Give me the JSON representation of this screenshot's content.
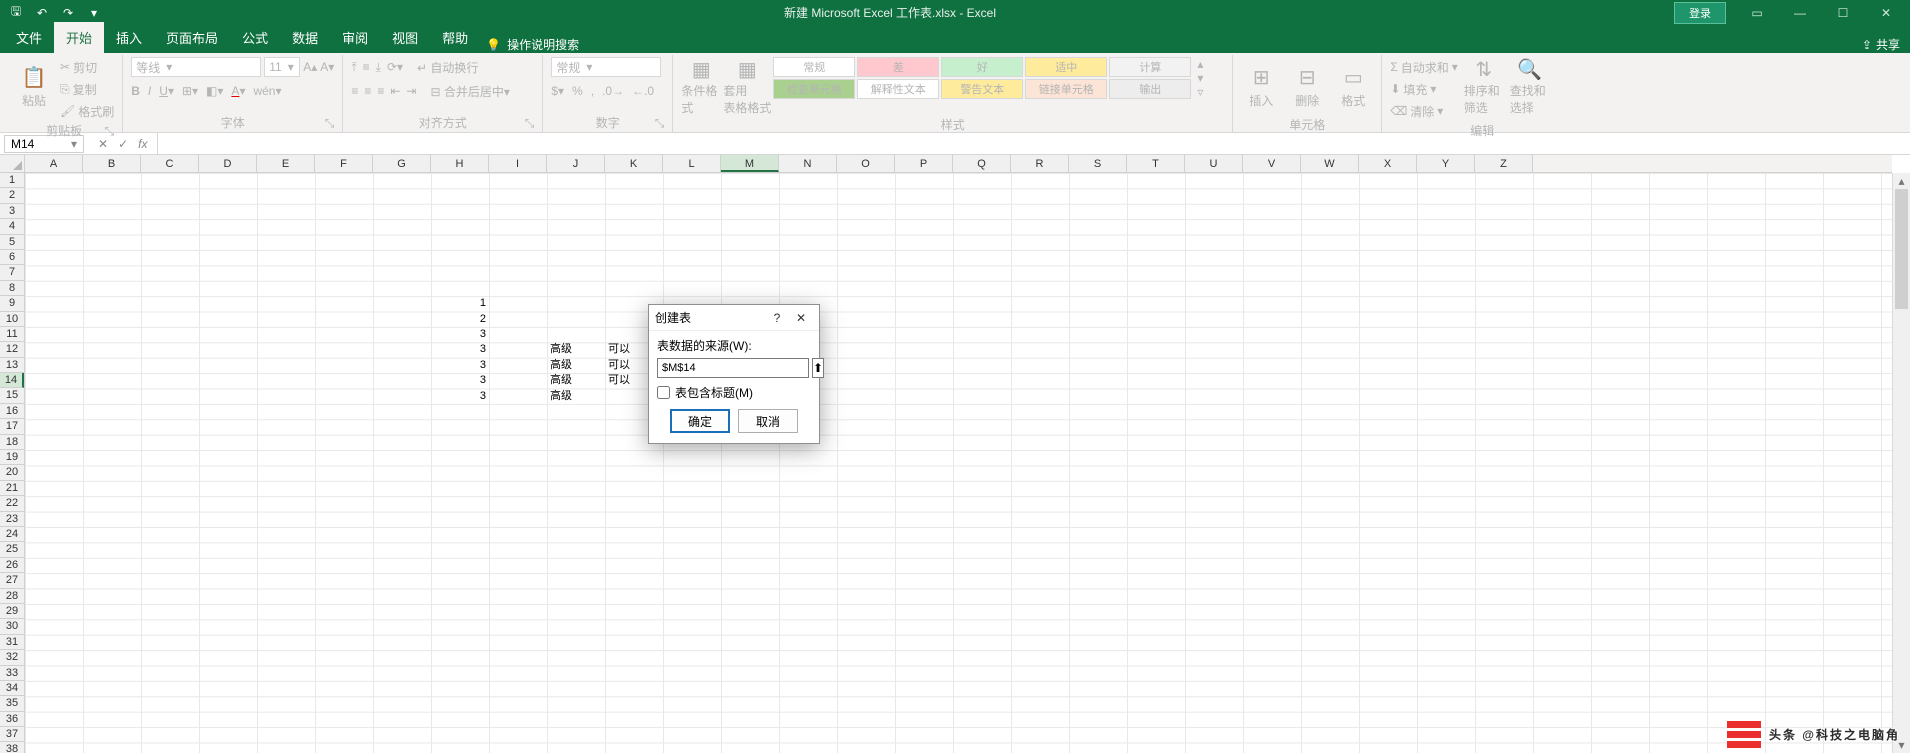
{
  "titlebar": {
    "title": "新建 Microsoft Excel 工作表.xlsx  -  Excel",
    "login": "登录"
  },
  "tabs": {
    "file": "文件",
    "home": "开始",
    "insert": "插入",
    "layout": "页面布局",
    "formulas": "公式",
    "data": "数据",
    "review": "审阅",
    "view": "视图",
    "help": "帮助",
    "tellme": "操作说明搜索",
    "share": "共享"
  },
  "ribbon": {
    "clipboard": {
      "paste": "粘贴",
      "cut": "剪切",
      "copy": "复制",
      "format_painter": "格式刷",
      "label": "剪贴板"
    },
    "font": {
      "family": "等线",
      "size": "11",
      "label": "字体"
    },
    "alignment": {
      "wrap": "自动换行",
      "merge": "合并后居中",
      "label": "对齐方式"
    },
    "number": {
      "format": "常规",
      "label": "数字"
    },
    "styles": {
      "cond": "条件格式",
      "as_table": "套用\n表格格式",
      "cells": [
        "常规",
        "差",
        "好",
        "适中",
        "计算",
        "检查单元格",
        "解释性文本",
        "警告文本",
        "链接单元格",
        "输出"
      ],
      "label": "样式"
    },
    "cells_group": {
      "insert": "插入",
      "delete": "删除",
      "format": "格式",
      "label": "单元格"
    },
    "editing": {
      "autosum": "自动求和",
      "fill": "填充",
      "clear": "清除",
      "sort": "排序和筛选",
      "find": "查找和选择",
      "label": "编辑"
    }
  },
  "namebox": {
    "ref": "M14"
  },
  "columns": [
    "A",
    "B",
    "C",
    "D",
    "E",
    "F",
    "G",
    "H",
    "I",
    "J",
    "K",
    "L",
    "M",
    "N",
    "O",
    "P",
    "Q",
    "R",
    "S",
    "T",
    "U",
    "V",
    "W",
    "X",
    "Y",
    "Z"
  ],
  "row_count": 38,
  "selected": {
    "col": "M",
    "row": 14
  },
  "cells": [
    {
      "col": "H",
      "row": 9,
      "v": "1",
      "align": "r"
    },
    {
      "col": "H",
      "row": 10,
      "v": "2",
      "align": "r"
    },
    {
      "col": "H",
      "row": 11,
      "v": "3",
      "align": "r"
    },
    {
      "col": "H",
      "row": 12,
      "v": "3",
      "align": "r"
    },
    {
      "col": "H",
      "row": 13,
      "v": "3",
      "align": "r"
    },
    {
      "col": "H",
      "row": 14,
      "v": "3",
      "align": "r"
    },
    {
      "col": "H",
      "row": 15,
      "v": "3",
      "align": "r"
    },
    {
      "col": "J",
      "row": 12,
      "v": "高级",
      "align": "l"
    },
    {
      "col": "J",
      "row": 13,
      "v": "高级",
      "align": "l"
    },
    {
      "col": "J",
      "row": 14,
      "v": "高级",
      "align": "l"
    },
    {
      "col": "J",
      "row": 15,
      "v": "高级",
      "align": "l"
    },
    {
      "col": "K",
      "row": 12,
      "v": "可以",
      "align": "l"
    },
    {
      "col": "K",
      "row": 13,
      "v": "可以",
      "align": "l"
    },
    {
      "col": "K",
      "row": 14,
      "v": "可以",
      "align": "l"
    }
  ],
  "dialog": {
    "title": "创建表",
    "source_label": "表数据的来源(W):",
    "source_value": "$M$14",
    "headers_label": "表包含标题(M)",
    "ok": "确定",
    "cancel": "取消"
  },
  "watermark": "头条 @科技之电脑角"
}
